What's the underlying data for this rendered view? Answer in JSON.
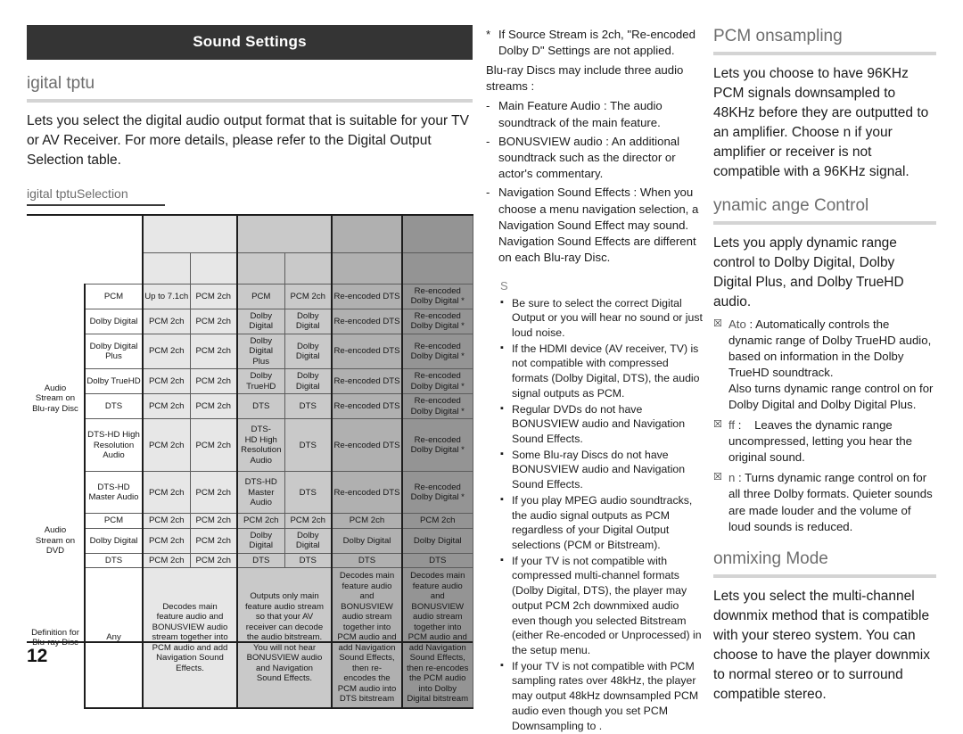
{
  "banner": {
    "title": "Sound Settings"
  },
  "left": {
    "heading_digital_output": "igital tptu",
    "paragraph_digital_output": "Lets you select the digital audio output format that is suitable for your TV or AV Receiver. For more details, please refer to the Digital Output Selection table.",
    "heading_selection": "igital tptuSelection"
  },
  "table": {
    "header_row_1": [
      "",
      "",
      "",
      "",
      "",
      ""
    ],
    "header_row_2": [
      "",
      "",
      "",
      "",
      "",
      "",
      ""
    ],
    "group_bluray_label": "Audio\nStream on\nBlu-ray Disc",
    "group_dvd_label": "Audio\nStream on\nDVD",
    "definition_label": "Definition for\nBlu-ray Disc",
    "bluray_rows": [
      {
        "source": "PCM",
        "c1": "Up to 7.1ch",
        "c2": "PCM 2ch",
        "c3": "PCM",
        "c4": "PCM 2ch",
        "c5": "Re-encoded DTS",
        "c6": "Re-encoded\nDolby Digital *"
      },
      {
        "source": "Dolby Digital",
        "c1": "PCM 2ch",
        "c2": "PCM 2ch",
        "c3": "Dolby\nDigital",
        "c4": "Dolby\nDigital",
        "c5": "Re-encoded DTS",
        "c6": "Re-encoded\nDolby Digital *"
      },
      {
        "source": "Dolby Digital\nPlus",
        "c1": "PCM 2ch",
        "c2": "PCM 2ch",
        "c3": "Dolby Digital\nPlus",
        "c4": "Dolby\nDigital",
        "c5": "Re-encoded DTS",
        "c6": "Re-encoded\nDolby Digital *"
      },
      {
        "source": "Dolby TrueHD",
        "c1": "PCM 2ch",
        "c2": "PCM 2ch",
        "c3": "Dolby\nTrueHD",
        "c4": "Dolby\nDigital",
        "c5": "Re-encoded DTS",
        "c6": "Re-encoded\nDolby Digital *"
      },
      {
        "source": "DTS",
        "c1": "PCM 2ch",
        "c2": "PCM 2ch",
        "c3": "DTS",
        "c4": "DTS",
        "c5": "Re-encoded DTS",
        "c6": "Re-encoded\nDolby Digital *"
      },
      {
        "source": "DTS-HD High\nResolution\nAudio",
        "c1": "PCM 2ch",
        "c2": "PCM 2ch",
        "c3": "DTS-\nHD High\nResolution\nAudio",
        "c4": "DTS",
        "c5": "Re-encoded DTS",
        "c6": "Re-encoded\nDolby Digital *"
      },
      {
        "source": "DTS-HD\nMaster Audio",
        "c1": "PCM 2ch",
        "c2": "PCM 2ch",
        "c3": "DTS-HD\nMaster\nAudio",
        "c4": "DTS",
        "c5": "Re-encoded DTS",
        "c6": "Re-encoded\nDolby Digital *"
      }
    ],
    "dvd_rows": [
      {
        "source": "PCM",
        "c1": "PCM 2ch",
        "c2": "PCM 2ch",
        "c3": "PCM 2ch",
        "c4": "PCM 2ch",
        "c5": "PCM 2ch",
        "c6": "PCM 2ch"
      },
      {
        "source": "Dolby Digital",
        "c1": "PCM 2ch",
        "c2": "PCM 2ch",
        "c3": "Dolby\nDigital",
        "c4": "Dolby\nDigital",
        "c5": "Dolby Digital",
        "c6": "Dolby Digital"
      },
      {
        "source": "DTS",
        "c1": "PCM 2ch",
        "c2": "PCM 2ch",
        "c3": "DTS",
        "c4": "DTS",
        "c5": "DTS",
        "c6": "DTS"
      }
    ],
    "definition_row": {
      "source": "Any",
      "c12": "Decodes main feature audio and BONUSVIEW audio stream together into PCM audio and add Navigation Sound Effects.",
      "c34": "Outputs only main feature audio stream so that your AV receiver can decode the audio bitstream.\nYou will not hear BONUSVIEW audio and Navigation Sound Effects.",
      "c5": "Decodes main feature audio and BONUSVIEW audio stream together into PCM audio and add Navigation Sound Effects, then re-encodes the PCM audio into DTS bitstream",
      "c6": "Decodes main feature audio and BONUSVIEW audio stream together into PCM audio and add Navigation Sound Effects, then re-encodes the PCM audio into Dolby Digital bitstream"
    }
  },
  "middle": {
    "star_marker": "*",
    "star_note": "If Source Stream is 2ch, \"Re-encoded Dolby D\" Settings are not applied.",
    "intro": "Blu-ray Discs may include three audio streams :",
    "dash_marker": "-",
    "dash_items": [
      "Main Feature Audio : The audio soundtrack of the main feature.",
      "BONUSVIEW audio : An additional soundtrack such as the director or actor's commentary.",
      "Navigation Sound Effects : When you choose a menu navigation selection, a Navigation Sound Effect may sound. Navigation Sound Effects are different on each Blu-ray Disc."
    ],
    "note_heading": "S",
    "bullet_marker": "▪",
    "bullets": [
      "Be sure to select the correct Digital Output or you will hear no sound or just loud noise.",
      "If the HDMI device (AV receiver, TV) is not compatible with compressed formats (Dolby Digital, DTS), the audio signal outputs as PCM.",
      "Regular DVDs do not have BONUSVIEW audio and Navigation Sound Effects.",
      "Some Blu-ray Discs do not have BONUSVIEW audio and Navigation Sound Effects.",
      "If you play MPEG audio soundtracks, the audio signal outputs as PCM regardless of your Digital Output selections (PCM or Bitstream).",
      "If your TV is not compatible with compressed multi-channel formats (Dolby Digital, DTS), the player may output PCM 2ch downmixed audio even though you selected Bitstream (either Re-encoded or Unprocessed) in the setup menu.",
      "If your TV is not compatible with PCM sampling rates over 48kHz, the player may output 48kHz downsampled PCM audio even though you set PCM Downsampling to ."
    ]
  },
  "right": {
    "heading_pcm": "PCM onsampling",
    "paragraph_pcm": "Lets you choose to have 96KHz PCM signals downsampled to 48KHz before they are outputted to an amplifier. Choose n if your amplifier or receiver is not compatible with a 96KHz signal.",
    "heading_drc": "ynamic ange Control",
    "paragraph_drc": "Lets you apply dynamic range control to Dolby Digital, Dolby Digital Plus, and Dolby TrueHD audio.",
    "option_marker": "☒",
    "options": [
      {
        "label": "Ato",
        "text": ": Automatically controls the dynamic range of Dolby TrueHD audio, based on information in the Dolby TrueHD soundtrack.",
        "extra": "Also turns dynamic range control on for Dolby Digital and Dolby Digital Plus."
      },
      {
        "label": "ff",
        "text": ":    Leaves the dynamic range uncompressed, letting you hear the original sound.",
        "extra": ""
      },
      {
        "label": "n",
        "text": ": Turns dynamic range control on for all three Dolby formats. Quieter sounds are made louder and the volume of loud sounds is reduced.",
        "extra": ""
      }
    ],
    "heading_downmix": "onmixing Mode",
    "paragraph_downmix": "Lets you select the multi-channel downmix method that is compatible with your stereo system. You can choose to have the player downmix to normal stereo or to surround compatible stereo."
  },
  "footer": {
    "page_number": "12"
  }
}
